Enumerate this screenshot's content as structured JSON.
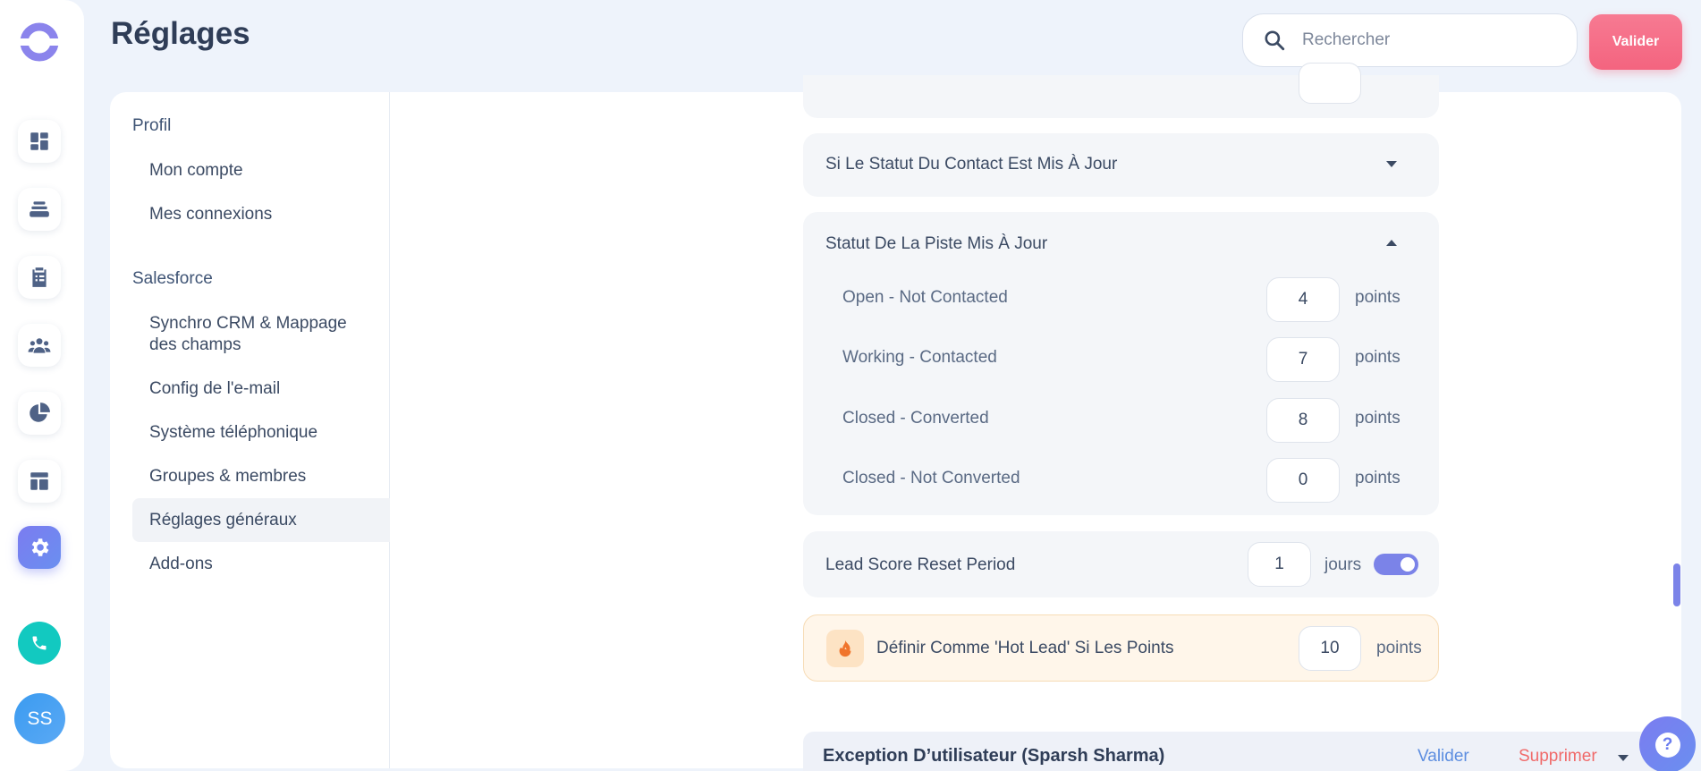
{
  "header": {
    "title": "Réglages",
    "search_placeholder": "Rechercher",
    "valider_label": "Valider"
  },
  "rail": {
    "icons": [
      "dashboard-icon",
      "stack-icon",
      "clipboard-icon",
      "team-icon",
      "pie-chart-icon",
      "layout-icon",
      "gear-icon"
    ],
    "active": "gear-icon",
    "phone_icon": "phone-icon",
    "avatar_initials": "SS"
  },
  "sidebar": {
    "sections": [
      {
        "label": "Profil",
        "items": [
          {
            "label": "Mon compte"
          },
          {
            "label": "Mes connexions"
          }
        ]
      },
      {
        "label": "Salesforce",
        "items": [
          {
            "label": "Synchro CRM & Mappage des champs"
          },
          {
            "label": "Config de l'e-mail"
          },
          {
            "label": "Système téléphonique"
          },
          {
            "label": "Groupes & membres"
          },
          {
            "label": "Réglages généraux",
            "active": true
          },
          {
            "label": "Add-ons"
          }
        ]
      }
    ]
  },
  "settings": {
    "contact_status_card": {
      "title": "Si Le Statut Du Contact Est Mis À Jour",
      "expanded": false
    },
    "lead_status_card": {
      "title": "Statut De La Piste Mis À Jour",
      "expanded": true,
      "rows": [
        {
          "label": "Open - Not Contacted",
          "value": "4",
          "unit": "points"
        },
        {
          "label": "Working - Contacted",
          "value": "7",
          "unit": "points"
        },
        {
          "label": "Closed - Converted",
          "value": "8",
          "unit": "points"
        },
        {
          "label": "Closed - Not Converted",
          "value": "0",
          "unit": "points"
        }
      ]
    },
    "reset_period": {
      "label": "Lead Score Reset Period",
      "value": "1",
      "unit": "jours",
      "toggle_on": true
    },
    "hot_lead": {
      "icon": "flame-icon",
      "label": "Définir Comme 'Hot Lead' Si Les Points",
      "value": "10",
      "unit": "points"
    }
  },
  "exception": {
    "title": "Exception D’utilisateur (Sparsh Sharma)",
    "valider_label": "Valider",
    "supprimer_label": "Supprimer"
  },
  "help_icon": "help-icon",
  "colors": {
    "accent": "#7b83e8",
    "primary_button": "#f4647f",
    "phone": "#12c9c0",
    "hot_lead_bg": "#fff6ea"
  }
}
